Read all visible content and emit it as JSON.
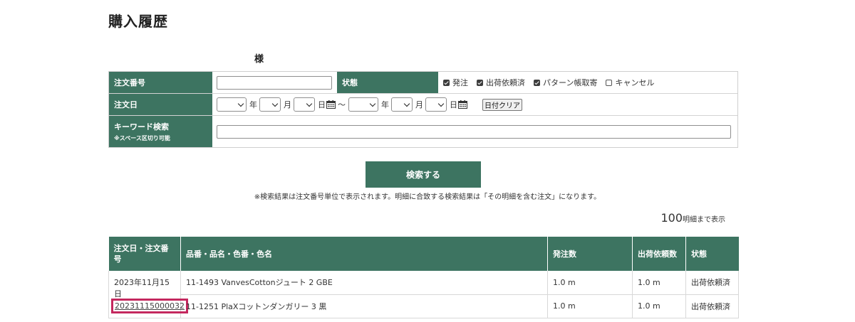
{
  "page": {
    "title": "購入履歴",
    "customer_honorific": "様"
  },
  "search_form": {
    "order_number_label": "注文番号",
    "order_number_value": "",
    "status_label": "状態",
    "statuses": [
      {
        "label": "発注",
        "checked": true
      },
      {
        "label": "出荷依頼済",
        "checked": true
      },
      {
        "label": "パターン帳取寄",
        "checked": true
      },
      {
        "label": "キャンセル",
        "checked": false
      }
    ],
    "order_date_label": "注文日",
    "date_units": {
      "year": "年",
      "month": "月",
      "day": "日"
    },
    "range_separator": "～",
    "date_clear_label": "日付クリア",
    "keyword_label": "キーワード検索",
    "keyword_sublabel": "※スペース区切り可能",
    "keyword_value": ""
  },
  "search_button_label": "検索する",
  "search_note": "※検索結果は注文番号単位で表示されます。明細に合致する検索結果は「その明細を含む注文」になります。",
  "display_count": {
    "number": "100",
    "suffix": "明細まで表示"
  },
  "results": {
    "headers": [
      "注文日・注文番号",
      "品番・品名・色番・色名",
      "発注数",
      "出荷依頼数",
      "状態"
    ],
    "orders": [
      {
        "date": "2023年11月15日",
        "number": "20231115000032",
        "items": [
          {
            "product": "11-1493 VanvesCottonジュート 2 GBE",
            "ordered": "1.0 m",
            "shipping_requested": "1.0 m",
            "status": "出荷依頼済"
          },
          {
            "product": "11-1251 PlaXコットンダンガリー 3 黒",
            "ordered": "1.0 m",
            "shipping_requested": "1.0 m",
            "status": "出荷依頼済"
          }
        ]
      }
    ]
  },
  "colors": {
    "accent_green": "#3d7461",
    "highlight": "#c4285e"
  }
}
